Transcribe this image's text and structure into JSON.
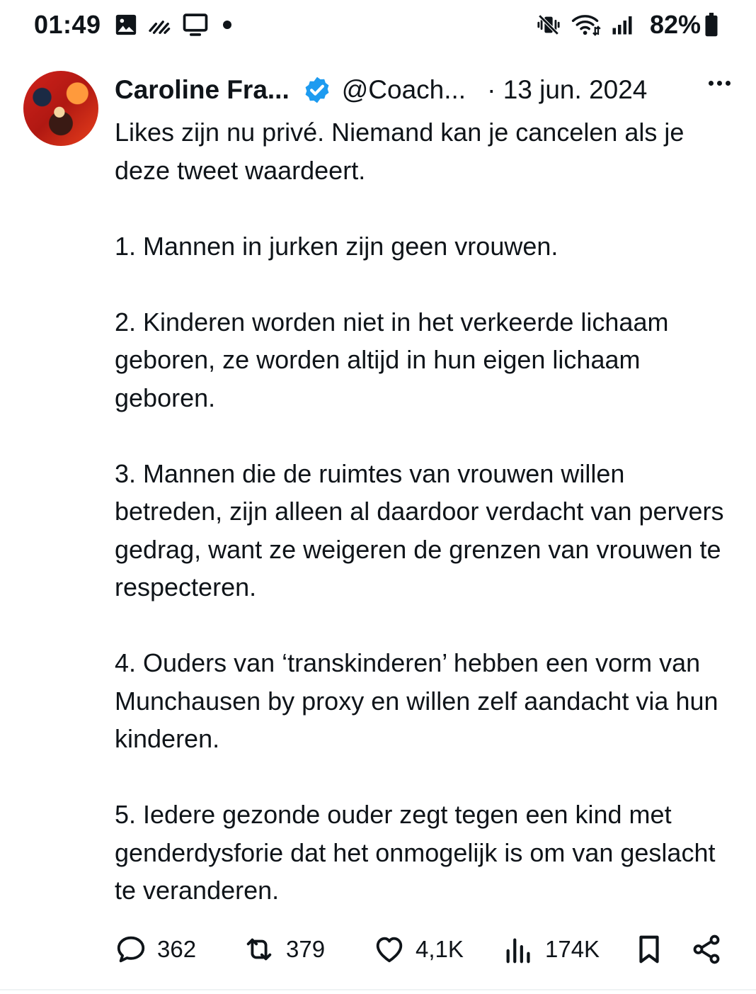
{
  "status_bar": {
    "time": "01:49",
    "icons_left": [
      "image-icon",
      "signal-activity-icon",
      "screen-cast-icon",
      "dot-icon"
    ],
    "icons_right": [
      "vibrate-mute-icon",
      "wifi-icon",
      "cell-signal-icon"
    ],
    "battery": "82%"
  },
  "tweet": {
    "display_name": "Caroline Fra...",
    "handle": "@Coach...",
    "date": "· 13 jun. 2024",
    "verified_color": "#1d9bf0",
    "paragraphs": [
      "Likes zijn nu privé. Niemand kan je cancelen als je deze tweet waardeert.",
      "1. Mannen in jurken zijn geen vrouwen.",
      "2. Kinderen worden niet in het verkeerde lichaam geboren, ze worden altijd in hun eigen lichaam geboren.",
      "3. Mannen die de ruimtes van vrouwen willen betreden, zijn alleen al daardoor verdacht van pervers gedrag, want ze weigeren de grenzen van vrouwen te respecteren.",
      "4. Ouders van ‘transkinderen’ hebben een vorm van Munchausen by proxy en willen zelf aandacht via hun kinderen.",
      "5. Iedere gezonde ouder zegt tegen een kind met genderdysforie dat het onmogelijk is om van geslacht te veranderen."
    ],
    "actions": {
      "replies": "362",
      "reposts": "379",
      "likes": "4,1K",
      "views": "174K"
    }
  }
}
